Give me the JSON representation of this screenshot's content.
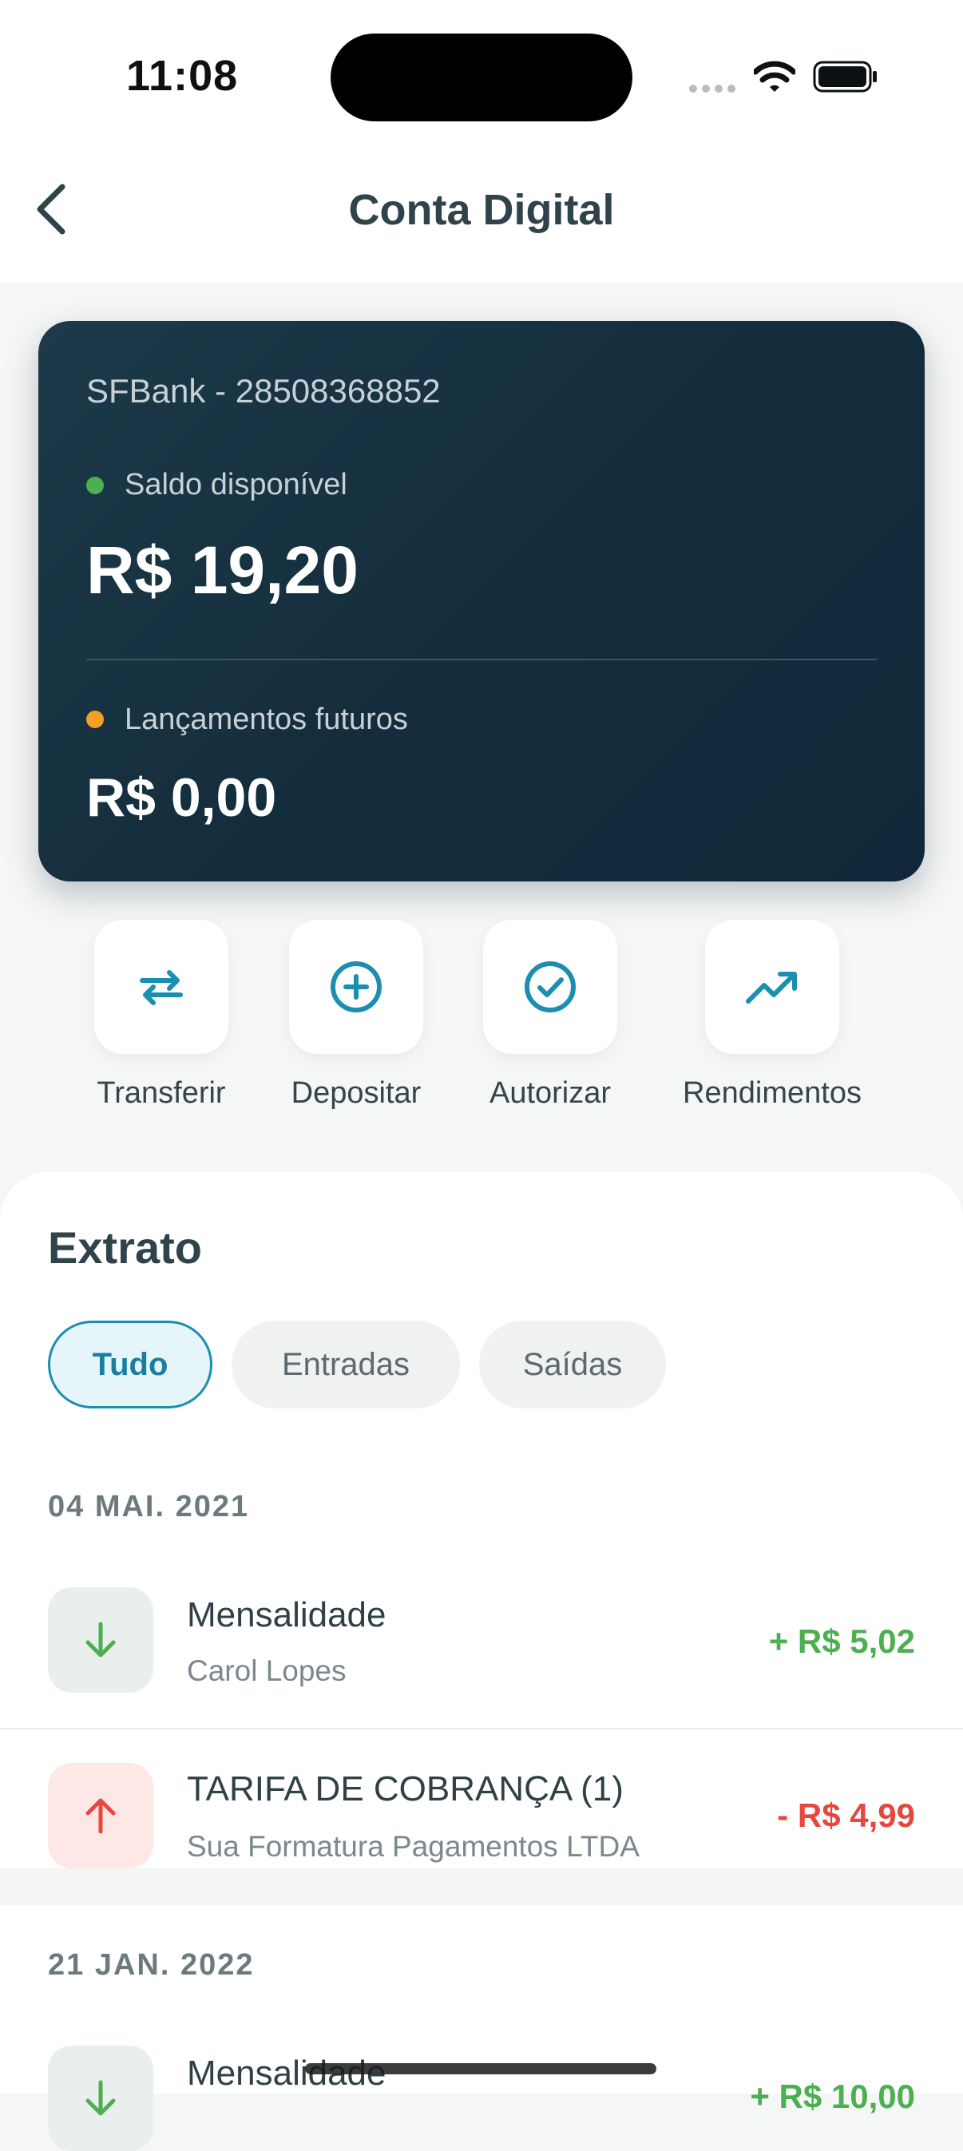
{
  "status_bar": {
    "time": "11:08"
  },
  "header": {
    "title": "Conta Digital"
  },
  "card": {
    "account_label": "SFBank - 28508368852",
    "available_label": "Saldo disponível",
    "available_value": "R$ 19,20",
    "future_label": "Lançamentos futuros",
    "future_value": "R$ 0,00",
    "colors": {
      "available_dot": "#4caf50",
      "future_dot": "#f5a023",
      "background": "#163244"
    }
  },
  "actions": [
    {
      "label": "Transferir",
      "icon": "transfer-arrows-icon"
    },
    {
      "label": "Depositar",
      "icon": "plus-circle-icon"
    },
    {
      "label": "Autorizar",
      "icon": "check-circle-icon"
    },
    {
      "label": "Rendimentos",
      "icon": "trending-up-icon"
    }
  ],
  "statement": {
    "title": "Extrato",
    "filters": [
      {
        "label": "Tudo",
        "selected": true
      },
      {
        "label": "Entradas",
        "selected": false
      },
      {
        "label": "Saídas",
        "selected": false
      }
    ],
    "groups": [
      {
        "date": "04 MAI. 2021",
        "transactions": [
          {
            "direction": "in",
            "icon": "arrow-down-icon",
            "title": "Mensalidade",
            "subtitle": "Carol Lopes",
            "amount": "+ R$ 5,02"
          },
          {
            "direction": "out",
            "icon": "arrow-up-icon",
            "title": "TARIFA DE COBRANÇA (1)",
            "subtitle": "Sua Formatura Pagamentos LTDA",
            "amount": "- R$ 4,99"
          }
        ]
      },
      {
        "date": "21 JAN. 2022",
        "transactions": [
          {
            "direction": "in",
            "icon": "arrow-down-icon",
            "title": "Mensalidade",
            "subtitle": "",
            "amount": "+ R$ 10,00"
          }
        ]
      }
    ],
    "colors": {
      "accent": "#1a8fb0",
      "income": "#4caf50",
      "expense": "#e5483f"
    }
  }
}
